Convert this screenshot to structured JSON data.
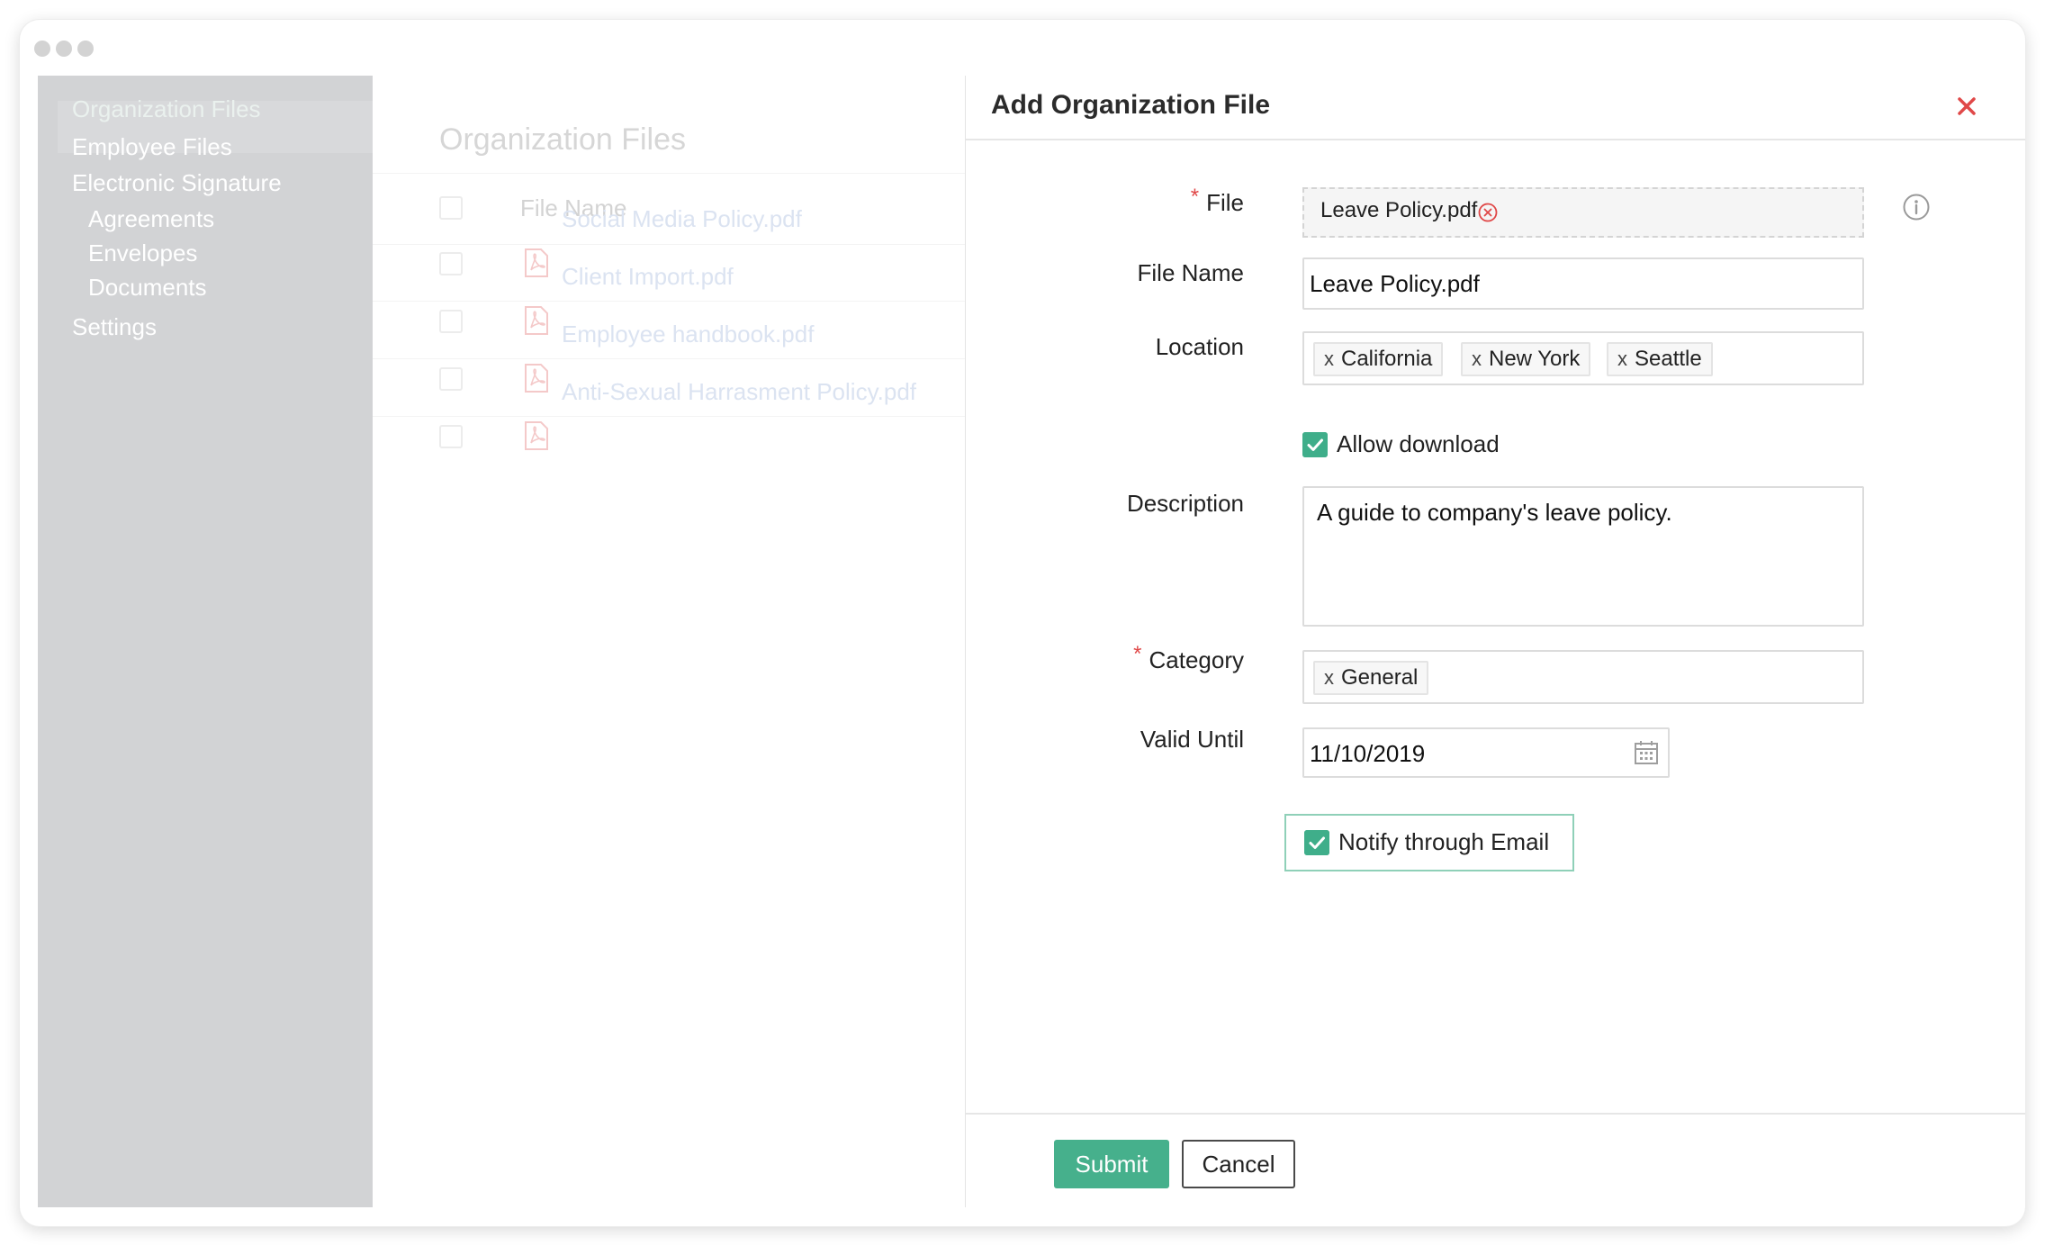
{
  "sidebar": {
    "items": [
      {
        "label": "Organization Files"
      },
      {
        "label": "Employee Files"
      },
      {
        "label": "Electronic Signature"
      },
      {
        "label": "Agreements"
      },
      {
        "label": "Envelopes"
      },
      {
        "label": "Documents"
      },
      {
        "label": "Settings"
      }
    ]
  },
  "list": {
    "title": "Organization Files",
    "column_header": "File Name",
    "files": [
      {
        "name": "Social Media Policy.pdf"
      },
      {
        "name": "Client Import.pdf"
      },
      {
        "name": "Employee handbook.pdf"
      },
      {
        "name": "Anti-Sexual Harrasment Policy.pdf"
      }
    ]
  },
  "modal": {
    "title": "Add Organization File",
    "close_icon": "close-icon",
    "accent_color": "#46b08c",
    "required_color": "#e04848",
    "fields": {
      "file": {
        "label": "File",
        "value": "Leave Policy.pdf"
      },
      "file_name": {
        "label": "File Name",
        "value": "Leave Policy.pdf"
      },
      "location": {
        "label": "Location",
        "tags": [
          "California",
          "New York",
          "Seattle"
        ],
        "remove_glyph": "x"
      },
      "allow_download": {
        "label": "Allow download",
        "checked": true
      },
      "description": {
        "label": "Description",
        "value": "A guide to company's leave policy."
      },
      "category": {
        "label": "Category",
        "tags": [
          "General"
        ],
        "remove_glyph": "x"
      },
      "valid_until": {
        "label": "Valid Until",
        "value": "11/10/2019"
      },
      "notify": {
        "label": "Notify through Email",
        "checked": true
      }
    },
    "buttons": {
      "submit": "Submit",
      "cancel": "Cancel"
    }
  }
}
